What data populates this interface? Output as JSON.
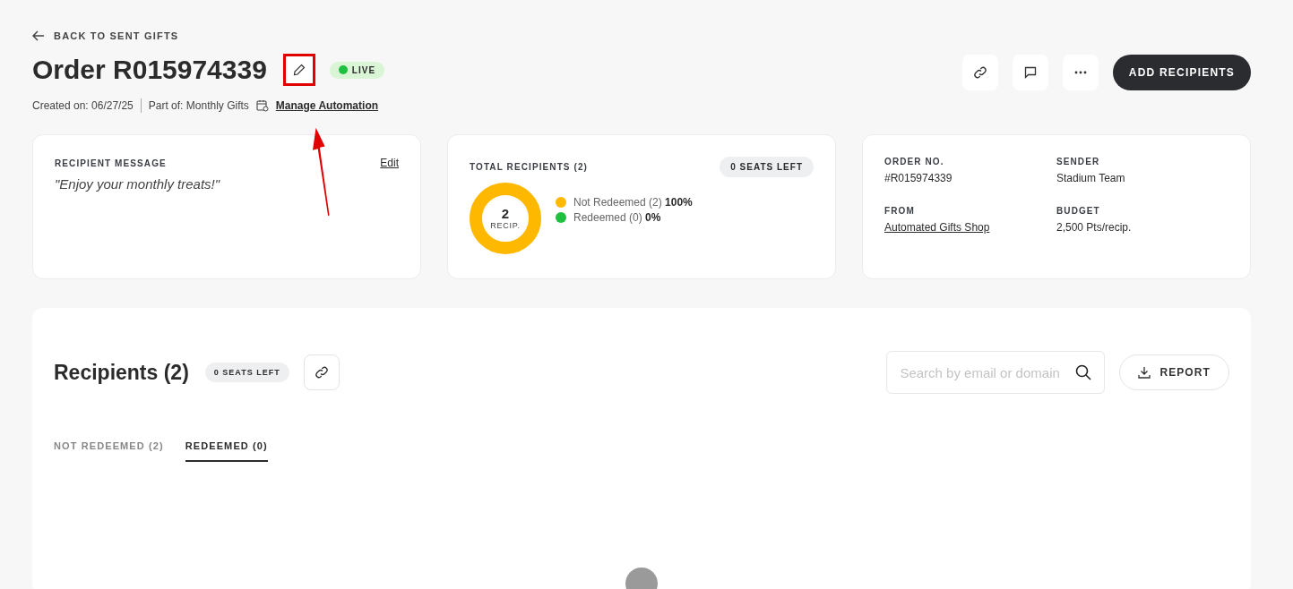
{
  "back_link": "BACK TO SENT GIFTS",
  "title": "Order R015974339",
  "status": {
    "label": "LIVE",
    "color": "#1fbf3f"
  },
  "meta": {
    "created": "Created on: 06/27/25",
    "part_of": "Part of: Monthly Gifts",
    "automation_link": "Manage Automation"
  },
  "actions": {
    "primary": "ADD RECIPIENTS"
  },
  "message_card": {
    "heading": "RECIPIENT MESSAGE",
    "edit": "Edit",
    "message": "\"Enjoy your monthly treats!\""
  },
  "totals_card": {
    "heading": "TOTAL RECIPIENTS (2)",
    "seats": "0 SEATS LEFT",
    "center_value": "2",
    "center_label": "RECIP.",
    "legend": [
      {
        "text": "Not Redeemed (2) **100%**",
        "color": "#ffb800"
      },
      {
        "text": "Redeemed (0) **0%**",
        "color": "#1fbf3f"
      }
    ]
  },
  "details_card": {
    "fields": [
      {
        "label": "ORDER NO.",
        "value": "#R015974339",
        "kind": "text"
      },
      {
        "label": "SENDER",
        "value": "Stadium Team",
        "kind": "text"
      },
      {
        "label": "FROM",
        "value": "Automated Gifts Shop",
        "kind": "link"
      },
      {
        "label": "BUDGET",
        "value": "2,500 Pts/recip.",
        "kind": "text"
      }
    ]
  },
  "recipients": {
    "title": "Recipients (2)",
    "seats": "0 SEATS LEFT",
    "search": {
      "placeholder": "Search by email or domain"
    },
    "report": "REPORT",
    "tabs": [
      {
        "label": "NOT REDEEMED (2)",
        "selected": false
      },
      {
        "label": "REDEEMED (0)",
        "selected": true
      }
    ]
  }
}
